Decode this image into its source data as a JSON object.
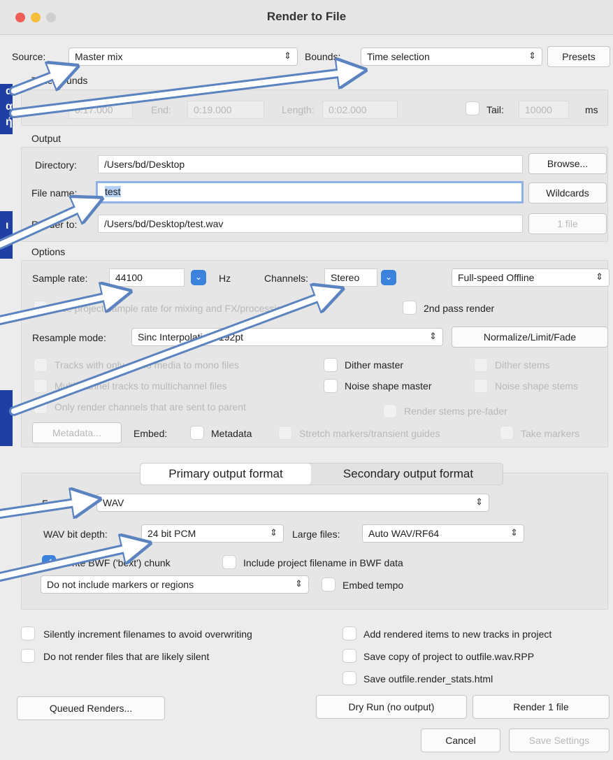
{
  "window": {
    "title": "Render to File"
  },
  "source": {
    "label": "Source:",
    "value": "Master mix"
  },
  "bounds": {
    "label": "Bounds:",
    "value": "Time selection",
    "presets": "Presets"
  },
  "time_bounds": {
    "group_label": "Time bounds",
    "start_label": "Start:",
    "start_value": "0:17.000",
    "end_label": "End:",
    "end_value": "0:19.000",
    "length_label": "Length:",
    "length_value": "0:02.000",
    "tail_label": "Tail:",
    "tail_value": "10000",
    "tail_unit": "ms"
  },
  "output": {
    "group_label": "Output",
    "directory_label": "Directory:",
    "directory_value": "/Users/bd/Desktop",
    "browse": "Browse...",
    "filename_label": "File name:",
    "filename_value": "test",
    "wildcards": "Wildcards",
    "render_to_label": "Render to:",
    "render_to_value": "/Users/bd/Desktop/test.wav",
    "file_count": "1 file"
  },
  "options": {
    "group_label": "Options",
    "sample_rate_label": "Sample rate:",
    "sample_rate_value": "44100",
    "hz": "Hz",
    "channels_label": "Channels:",
    "channels_value": "Stereo",
    "speed_value": "Full-speed Offline",
    "use_project_rate": "Use project sample rate for mixing and FX/processing",
    "second_pass": "2nd pass render",
    "resample_label": "Resample mode:",
    "resample_value": "Sinc Interpolation: 192pt",
    "normalize": "Normalize/Limit/Fade",
    "mono_tracks": "Tracks with only mono media to mono files",
    "dither_master": "Dither master",
    "dither_stems": "Dither stems",
    "multichannel": "Multichannel tracks to multichannel files",
    "noise_master": "Noise shape master",
    "noise_stems": "Noise shape stems",
    "only_render": "Only render channels that are sent to parent",
    "stems_prefader": "Render stems pre-fader",
    "metadata_btn": "Metadata...",
    "embed_label": "Embed:",
    "embed_metadata": "Metadata",
    "stretch_markers": "Stretch markers/transient guides",
    "take_markers": "Take markers"
  },
  "format": {
    "tab_primary": "Primary output format",
    "tab_secondary": "Secondary output format",
    "format_label": "Format:",
    "format_value": "WAV",
    "bitdepth_label": "WAV bit depth:",
    "bitdepth_value": "24 bit PCM",
    "largefiles_label": "Large files:",
    "largefiles_value": "Auto WAV/RF64",
    "bwf_chunk": "Write BWF ('bext') chunk",
    "include_project": "Include project filename in BWF data",
    "markers_value": "Do not include markers or regions",
    "embed_tempo": "Embed tempo"
  },
  "footer": {
    "silently_increment": "Silently increment filenames to avoid overwriting",
    "not_render_silent": "Do not render files that are likely silent",
    "add_rendered": "Add rendered items to new tracks in project",
    "save_copy": "Save copy of project to outfile.wav.RPP",
    "save_stats": "Save outfile.render_stats.html",
    "queued": "Queued Renders...",
    "dry_run": "Dry Run (no output)",
    "render": "Render 1 file",
    "cancel": "Cancel",
    "save_settings": "Save Settings"
  },
  "annotations": {
    "a1": [
      "α",
      "α",
      "ή"
    ],
    "a2": [
      "ι",
      "t"
    ]
  },
  "colors": {
    "accent": "#3b82dd",
    "annotation": "#1f3fa4",
    "arrow": "#5b83c0"
  }
}
